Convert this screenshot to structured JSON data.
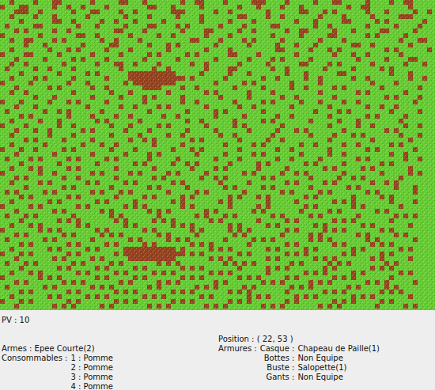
{
  "map": {
    "legend": [
      {
        "symbol": ".",
        "name": "grass",
        "color": "#66cc33"
      },
      {
        "symbol": "#",
        "name": "dirt",
        "color": "#97431f"
      }
    ],
    "rows": [
      "..#....#...##......#.....##...#.......#..##....#.....###....#.....#...##.....#....#..##.....#",
      "#...##.....#..#..#....#........##...#.....#.......#...#....#...#.........#..##........#....",
      "...###..#......#...##....#..#.......###......#..#.......#......##...#.#......#...#.....#..#",
      "..#....#...#......#.......#....#.....#....#.......##....#..#.......#....#.....#.....###....",
      "....#......##..#.....#..#...#.....#.......#.....#....#........#...#.....##.....#.#.......#.",
      ".#.....##.......#...#.....#....##....#.#......#....#.....##.......#..#.......#.....#....#..",
      "...#.#.....#..#.........##....#.......#....##.....#..#......#..##.....#...#.....##.....#...",
      "#.......#.......##..#......#.....#..#......#....#........#.....#.....##......#.#.....#.....",
      "..#..##....#.#.......#..#....#..........##....#....#.#.....#.......#....#...........#...##.",
      ".....#...#.......#.....##......#...#.#.......#......#.....#...#...#.......##..#.......#....",
      "..#.......#...#.#.....#....#.......#.......#....#.........##.....#...#.#.........#.#......#",
      "#....##.....#......#.....#.....#.#.....#.#......##....#.......#.......#...#..#......#.....",
      "...#.....#.....#.#....#.......#......#.......#......#....#.#.....#.........#.....#....##...",
      "..#..#.......#......#...##..#....#......#..#......#.....#......##....#.#......#......#...#.",
      ".#.....#..#....#.........#......#..#.......#....##.......#..#.......#.....#.....#.#.......",
      "....#.......#.....#.#......##########.....#.....#...#.......#...#......##.........#...#...",
      "..#....#.#.....#......#....############.#......#.......#..#.....#..#......#..#........#..#",
      "#.....#.......#...#.......#.#########........#.....#.#.......#.....#..........#....#......",
      "...#......#.#......#..#.......####....#..#.......#.....#.....#..#.....#.#.......#.......#.",
      "..#..#.........#.......#...#.......#.......#.#......#....#.........#.......#.#.......#....",
      ".......#...#.......#.....#....#.#.....#.......#.....#......#..#.......#..........#.#....#.",
      "#...#.....#...#.#.....#.......#.......#..#.......#.....#.#.....#...#....#..#...........#..",
      "...#...#..........#......#..#....#.#.......#......#..#.......#.......#.......#..#..#......",
      ".#.......#..#.#......#.........#.......#.....#.#.......#..........#....#.#........#.....#.",
      "....#.#.......#....#....#..#......#..#.......#.....#......#..#.......#.......#.#.....#....",
      "..#.....#...#.......#.#......#.........#..#......#.....#.#.......#.....#...#........#.....",
      "#....#......#..#.......#...#.....#.#.......#.....#.#.......#.........#.....#..#......#..#.",
      "...#...#..#......#.#......#....#.......#.....#......#.....#...#.#.......#........#.#......",
      "..#.......#....#.......#.....#.....#..#.......#..#.......#.......#....#...#.#.......#...#.",
      ".....#.#.....#.....#.......#..#.#.......#.#.......#.....#..#.........#........#.......#...",
      "..#......#.......#...#..#.......#.....#........#.....#.#.......#..#.....#..#......#.#.....",
      "#...#..#.....#.#.......#....#.......#...#.#.......#.......#..#.......#.......#.#.......#..",
      "...#.......#.......#......#....#.#.......#.....#.....#.#.......#.....#..#.........#..#....",
      ".#....#.#.....#.#.....#.#......#.....#.......#....#.......#..#.....#.......#.#.......#..#.",
      "....#.......#.......#.......#.#.....#..#.#......#.....#.#.......#.#.....#.......#.#.......",
      "..#...#.#.....#.#.......#.......#.......#....#.#......#.....#.......#.#.....#.#.......#...",
      "#.......#..#.......#.#.....#.#.....#.#.....#.......#.#.....#..#.#.......#.......#.....#.#.",
      "...#.#.......#..#.......#.......#.#.......#..#.#.......#.#.......#.....#..#.#.......#.....",
      "..#.....#.#.......#.#.....#.#.......#.#.......#.....#.......#.#.....#.#.......#..#.#......",
      ".....#.......#.#.......#.......#.#.....#.......#.#.....#.#.......#.......#.#.......#...#..",
      ".#.#.....#.#.......#.#...#.#.......#.....#.#.......#.......#.#.....#.#.......#.#.......#.",
      "....#.#.......#.#.......#.....#.#.....#.#.......#.#...#.#.......#.#.......#.....#.#......",
      "..#.......#.#.......#.#.....#.......#.#.......#.#.......#.....#.......#.#.#.......#....#.",
      "#.....#.#.......#.#.......#.#.#.......#.#.......#.....#.#.......#.#.......#.#.......#....",
      "...#.......#.#.......#.#.......#.#.#.......#.#.......#.#.......#.....#.#.......#.#.......",
      ".#...#.#.......#.......#.#.......#.......#.#...#.#.......#.#.....#.#.......#.......#.#.#.",
      "....#.......#.#.#.......#.#.....#.#.#.......#.#.......#.....#.#.......#.#.#.......#......",
      "..#...#.#.......#.#.......#.#.......#.#.#.......#.#.....#.#.......#.#.......#.#.......#..",
      "#.......#.#.#.......#.#.......#.#.......#.#.....#.#.#.......#.#.....#.#.#.......#.#......",
      "...#.#.......#.#.....#.#.#.......#.#.....#.......#.#.......#.....#.#.......#.#.....#.#...",
      ".#.......#.#.......#.......#.#.....#.#.#.......#.....#.#.#.......#.#.#.......#.#.......#.",
      "....#.#.......#.#.....#.#.....#.#.......#.#.#.......#.......#.#.......#.#.....#.#.#......",
      "..#.......#.#.....#.#.....###########.#.....#.#.#.......#.#.....#.#.......#.#.......#.#..",
      "#...#.#.......#.#.......#.#############.#.#.......#.#.......#.#.#.......#.#.....#.#......",
      "...#.......#.#.....#.#.....##########.......#.#.#.......#.#.......#.#.#.......#.#.....#..",
      ".#...#.#.......#.#.....#.#.......#.#.#.........#.#.#.#.......#.#.....#.#.#.......#.#.....",
      "....#.......#.#.....#.#.....#.#.......#.#.#.......#.....#.#.#.......#.#.......#.#.#......",
      "..#...#.#.......#.#.....#.#.....#.#.#.......#.#.#.......#.......#.#.#.....#.#.......#.#..",
      "#.......#.#.#.......#.#.....#.#.......#.#.#.......#.#.#.....#.#.......#.#.#.......#......",
      "...#.#.......#.#.#.......#.#.....#.#.#.......#.#.......#.#.#.....#.#.#.......#.#.#.....#.",
      ".#.......#.#.......#.#.#.......#.#.......#.#.#.....#.#.......#.#.#.......#.#.....#.#.....",
      "....#.#.......#.#.......#.#.#.......#.#.#.......#.#.#.......#.......#.#.#.......#.#.#....",
      "..#.......#.#.....#.#.#.......#.#.#.......#.#.......#.#.#.....#.#.#.......#.#.#.......#..",
      "#...#.#.......#.#.......#.#.#.......#.#.#.......#.#.#.......#.#.......#.#.#.....#.#......",
      "...#.......#.#.#.....#.#.......#.#.#.......#.#.#.......#.#.#.......#.#.#.......#.....#.#."
    ]
  },
  "status": {
    "hp": "PV : 10",
    "position": "Position : ( 22, 53 )",
    "weapons": "Armes : Epee Courte(2)",
    "consumables_label": "Consommables :",
    "consumables": [
      "1 : Pomme",
      "2 : Pomme",
      "3 : Pomme",
      "4 : Pomme"
    ],
    "armor_label": "Armures :",
    "armor": [
      {
        "slot": "Casque :",
        "value": "Chapeau de Paille(1)"
      },
      {
        "slot": "Bottes :",
        "value": "Non Equipe"
      },
      {
        "slot": "Buste :",
        "value": "Salopette(1)"
      },
      {
        "slot": "Gants :",
        "value": "Non Equipe"
      }
    ]
  }
}
